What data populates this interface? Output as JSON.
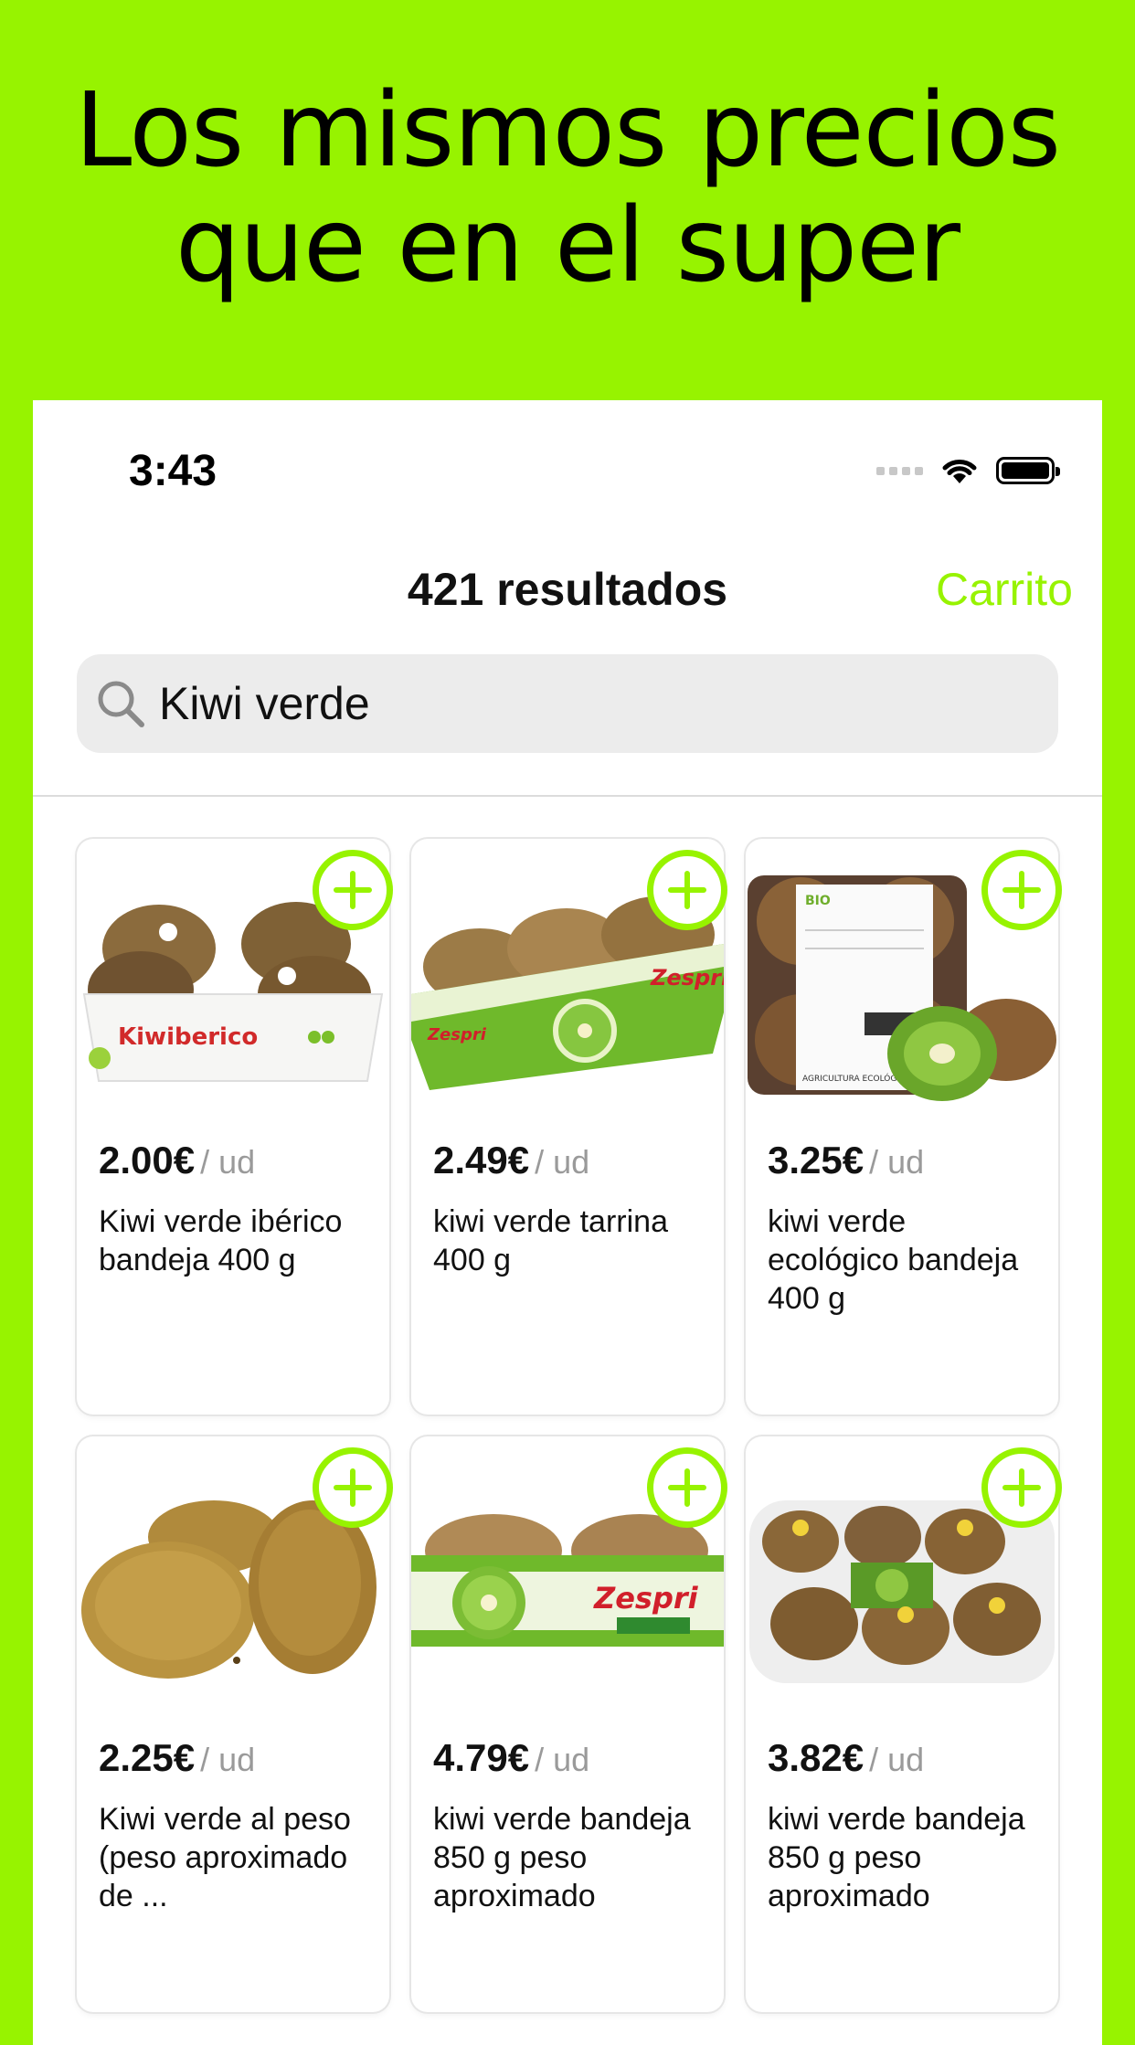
{
  "headline": {
    "line1": "Los mismos precios",
    "line2": "que en el super"
  },
  "status_bar": {
    "time": "3:43"
  },
  "nav": {
    "title": "421 resultados",
    "cart": "Carrito"
  },
  "search": {
    "value": "Kiwi verde",
    "icon": "search-icon"
  },
  "accent_color": "#97f300",
  "products": [
    {
      "price": "2.00€",
      "unit": "/ ud",
      "name": "Kiwi verde ibérico bandeja 400 g",
      "brand_text": "Kiwiberico"
    },
    {
      "price": "2.49€",
      "unit": "/ ud",
      "name": "kiwi verde tarrina 400 g",
      "brand_text": "Zespri"
    },
    {
      "price": "3.25€",
      "unit": "/ ud",
      "name": "kiwi verde ecológico bandeja 400 g",
      "brand_text": "AGRICULTURA ECOLÓGICA"
    },
    {
      "price": "2.25€",
      "unit": "/ ud",
      "name": "Kiwi verde al peso (peso aproximado de ..."
    },
    {
      "price": "4.79€",
      "unit": "/ ud",
      "name": "kiwi verde bandeja 850 g peso aproximado",
      "brand_text": "Zespri"
    },
    {
      "price": "3.82€",
      "unit": "/ ud",
      "name": "kiwi verde bandeja 850 g peso aproximado"
    }
  ]
}
